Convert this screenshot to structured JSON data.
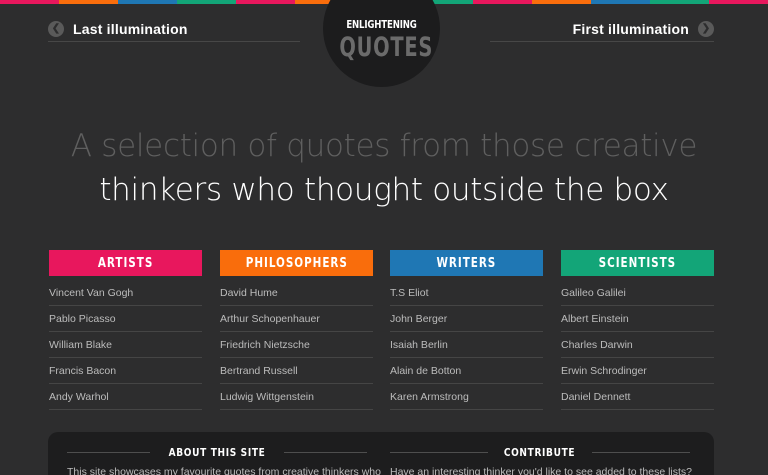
{
  "colors": {
    "background": "#2d2d2e",
    "artists": "#e8175d",
    "philosophers": "#f96d0c",
    "writers": "#1f77b4",
    "scientists": "#13a578",
    "stripe": [
      "#e8175d",
      "#f96d0c",
      "#1f77b4",
      "#13a578",
      "#e8175d",
      "#f96d0c",
      "#1f77b4",
      "#13a578",
      "#e8175d",
      "#f96d0c",
      "#1f77b4",
      "#13a578",
      "#e8175d"
    ]
  },
  "nav": {
    "prev_label": "Last illumination",
    "prev_icon": "chevron-left-icon",
    "next_label": "First illumination",
    "next_icon": "chevron-right-icon"
  },
  "logo": {
    "line1": "ENLIGHTENING",
    "line2": "QUOTES"
  },
  "hero": {
    "line1": "A selection of quotes from those creative",
    "line2": "thinkers who thought outside the box"
  },
  "categories": [
    {
      "title": "ARTISTS",
      "items": [
        "Vincent Van Gogh",
        "Pablo Picasso",
        "William Blake",
        "Francis Bacon",
        "Andy Warhol"
      ]
    },
    {
      "title": "PHILOSOPHERS",
      "items": [
        "David Hume",
        "Arthur Schopenhauer",
        "Friedrich Nietzsche",
        "Bertrand Russell",
        "Ludwig Wittgenstein"
      ]
    },
    {
      "title": "WRITERS",
      "items": [
        "T.S Eliot",
        "John Berger",
        "Isaiah Berlin",
        "Alain de Botton",
        "Karen Armstrong"
      ]
    },
    {
      "title": "SCIENTISTS",
      "items": [
        "Galileo Galilei",
        "Albert Einstein",
        "Charles Darwin",
        "Erwin Schrodinger",
        "Daniel Dennett"
      ]
    }
  ],
  "footer": {
    "about_title": "ABOUT THIS SITE",
    "about_text": "This site showcases my favourite quotes from creative thinkers who",
    "contribute_title": "CONTRIBUTE",
    "contribute_text": "Have an interesting thinker you'd like to see added to these lists?"
  }
}
